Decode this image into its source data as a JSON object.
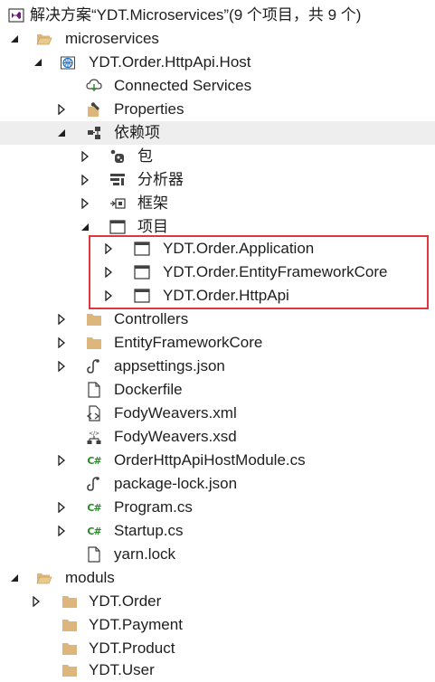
{
  "tree": {
    "solution_label": "解决方案“YDT.Microservices”(9 个项目，共 9 个)",
    "folder_microservices": "microservices",
    "project_host": "YDT.Order.HttpApi.Host",
    "connected_services": "Connected Services",
    "properties": "Properties",
    "dependencies": "依赖项",
    "packages": "包",
    "analyzers": "分析器",
    "frameworks": "框架",
    "projects": "项目",
    "proj_application": "YDT.Order.Application",
    "proj_efcore": "YDT.Order.EntityFrameworkCore",
    "proj_httpapi": "YDT.Order.HttpApi",
    "controllers": "Controllers",
    "efcore_folder": "EntityFrameworkCore",
    "appsettings": "appsettings.json",
    "dockerfile": "Dockerfile",
    "fody_xml": "FodyWeavers.xml",
    "fody_xsd": "FodyWeavers.xsd",
    "host_module": "OrderHttpApiHostModule.cs",
    "package_lock": "package-lock.json",
    "program": "Program.cs",
    "startup": "Startup.cs",
    "yarn_lock": "yarn.lock",
    "folder_moduls": "moduls",
    "ydt_order": "YDT.Order",
    "ydt_payment": "YDT.Payment",
    "ydt_product": "YDT.Product",
    "ydt_user": "YDT.User"
  },
  "colors": {
    "selected_row": "#eeeeef",
    "highlight_border": "#e0373f",
    "folder": "#dcb67a",
    "csharp": "#2a8a2a",
    "vs_purple": "#68217a"
  }
}
